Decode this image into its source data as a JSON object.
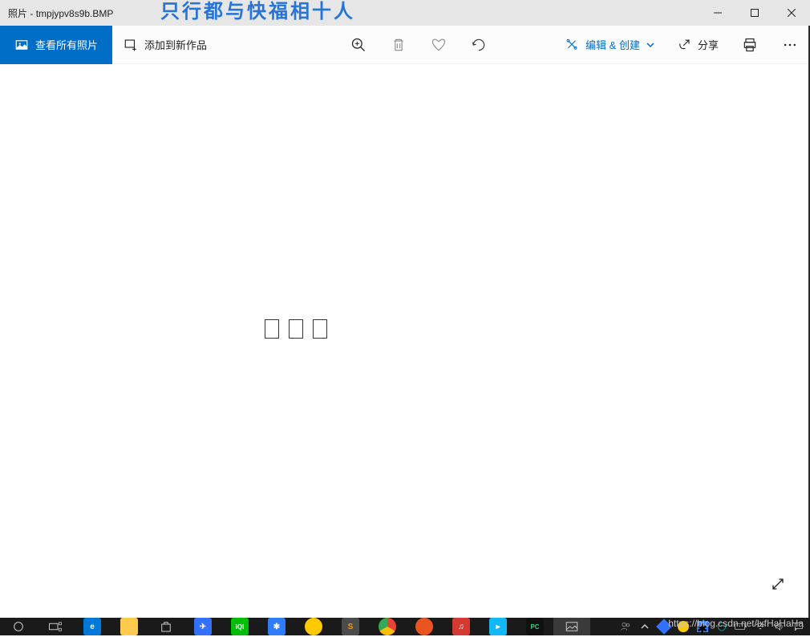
{
  "window": {
    "app_name": "照片",
    "separator": " - ",
    "filename": "tmpjypv8s9b.BMP"
  },
  "overlay_text": "只行都与快福相十人",
  "toolbar": {
    "view_all": "查看所有照片",
    "add_to_work": "添加到新作品",
    "edit_create": "编辑 & 创建",
    "share": "分享"
  },
  "watermark": "https://blog.csdn.net/lxfHaHaHa",
  "taskbar": {
    "apps": [
      {
        "name": "cortana",
        "color": "#1a1a1a"
      },
      {
        "name": "taskview",
        "color": "#1a1a1a"
      },
      {
        "name": "edge",
        "color": "#0078d7"
      },
      {
        "name": "explorer",
        "color": "#ffcb4f"
      },
      {
        "name": "store",
        "color": "#1a1a1a"
      },
      {
        "name": "feishu",
        "color": "#3370ff"
      },
      {
        "name": "iqiyi",
        "color": "#00be06"
      },
      {
        "name": "rm",
        "color": "#2f7cff"
      },
      {
        "name": "360",
        "color": "#fec900"
      },
      {
        "name": "sublime",
        "color": "#4b4b4b"
      },
      {
        "name": "chrome",
        "color": "#ea4335"
      },
      {
        "name": "ubuntu",
        "color": "#e95420"
      },
      {
        "name": "netease",
        "color": "#d33a31"
      },
      {
        "name": "tencent",
        "color": "#12b7f5"
      },
      {
        "name": "pycharm",
        "color": "#21d789"
      },
      {
        "name": "photos",
        "color": "#3a3a3a",
        "active": true
      }
    ]
  }
}
